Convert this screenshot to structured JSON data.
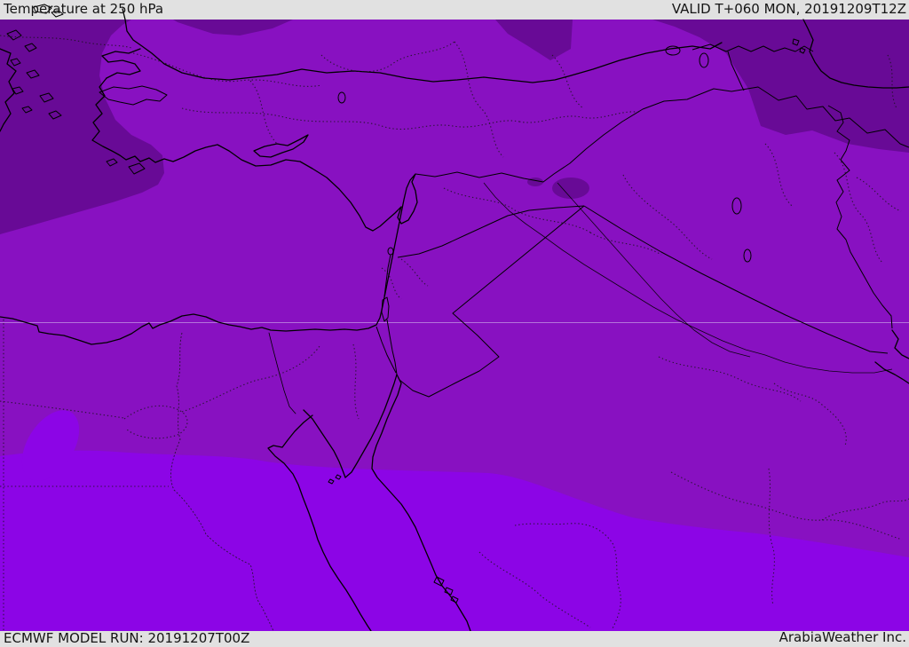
{
  "header": {
    "title": "Temperature at 250 hPa",
    "valid": "VALID T+060 MON, 20191209T12Z",
    "bar_color": "#e1e1e1",
    "text_color": "#151515"
  },
  "footer": {
    "model_run": "ECMWF MODEL RUN: 20191207T00Z",
    "credit": "ArabiaWeather Inc."
  },
  "map": {
    "kind": "filled contour temperature map, Middle East region",
    "bands": [
      {
        "name": "coldest-band",
        "color": "#680a96"
      },
      {
        "name": "cold-band",
        "color": "#8811c1"
      },
      {
        "name": "milder-band",
        "color": "#8c05e6"
      }
    ],
    "coastline_color": "#000000",
    "border_style": "solid national, dotted administrative",
    "gridline_color": "#d8c2ee"
  }
}
